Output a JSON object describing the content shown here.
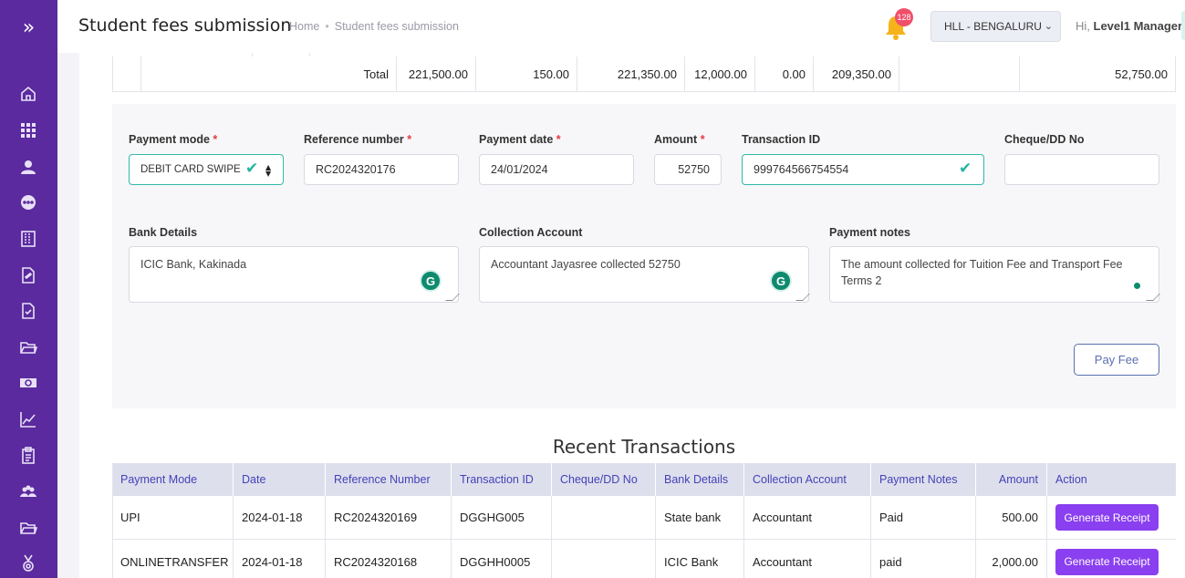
{
  "header": {
    "title": "Student fees submission",
    "breadcrumb": [
      "Home",
      "Student fees submission"
    ],
    "notification_count": "128",
    "branch": "HLL - BENGALURU",
    "greeting_prefix": "Hi,",
    "user_name": "Level1 Manager"
  },
  "sidebar": {
    "toggle_icon": "chevron-double-right-icon",
    "items": [
      "home-icon",
      "grid-icon",
      "user-icon",
      "more-icon",
      "building-icon",
      "document-edit-icon",
      "document-check-icon",
      "folder-open-icon",
      "money-icon",
      "chart-icon",
      "clipboard-icon",
      "users-icon",
      "folder-icon",
      "medal-icon"
    ]
  },
  "totals": {
    "label": "Total",
    "values": [
      "221,500.00",
      "150.00",
      "221,350.00",
      "12,000.00",
      "0.00",
      "209,350.00",
      "",
      "52,750.00"
    ]
  },
  "form": {
    "payment_mode": {
      "label": "Payment mode",
      "required": "*",
      "value": "DEBIT CARD SWIPE"
    },
    "reference_number": {
      "label": "Reference number",
      "required": "*",
      "value": "RC2024320176"
    },
    "payment_date": {
      "label": "Payment date",
      "required": "*",
      "value": "24/01/2024"
    },
    "amount": {
      "label": "Amount",
      "required": "*",
      "value": "52750"
    },
    "transaction_id": {
      "label": "Transaction ID",
      "value": "999764566754554"
    },
    "cheque_dd_no": {
      "label": "Cheque/DD No",
      "value": ""
    },
    "bank_details": {
      "label": "Bank Details",
      "value": "ICIC Bank, Kakinada"
    },
    "collection_account": {
      "label": "Collection Account",
      "value": "Accountant Jayasree collected 52750"
    },
    "payment_notes": {
      "label": "Payment notes",
      "value": "The amount collected for Tuition Fee and Transport Fee Terms 2"
    },
    "grammarly_glyph": "G",
    "submit_label": "Pay Fee"
  },
  "recent": {
    "title": "Recent Transactions",
    "columns": [
      "Payment Mode",
      "Date",
      "Reference Number",
      "Transaction ID",
      "Cheque/DD No",
      "Bank Details",
      "Collection Account",
      "Payment Notes",
      "Amount",
      "Action"
    ],
    "rows": [
      {
        "mode": "UPI",
        "date": "2024-01-18",
        "ref": "RC2024320169",
        "txn": "DGGHG005",
        "cheque": "",
        "bank": "State bank",
        "account": "Accountant",
        "notes": "Paid",
        "amount": "500.00",
        "action": "Generate Receipt"
      },
      {
        "mode": "ONLINETRANSFER",
        "date": "2024-01-18",
        "ref": "RC2024320168",
        "txn": "DGGHH0005",
        "cheque": "",
        "bank": "ICIC Bank",
        "account": "Accountant",
        "notes": "paid",
        "amount": "2,000.00",
        "action": "Generate Receipt"
      }
    ]
  },
  "colors": {
    "sidebar": "#5a2a9e",
    "valid": "#2fb9a8",
    "header_text": "#4640b9",
    "action_button": "#8a3ff0",
    "badge": "#f04f6a"
  }
}
